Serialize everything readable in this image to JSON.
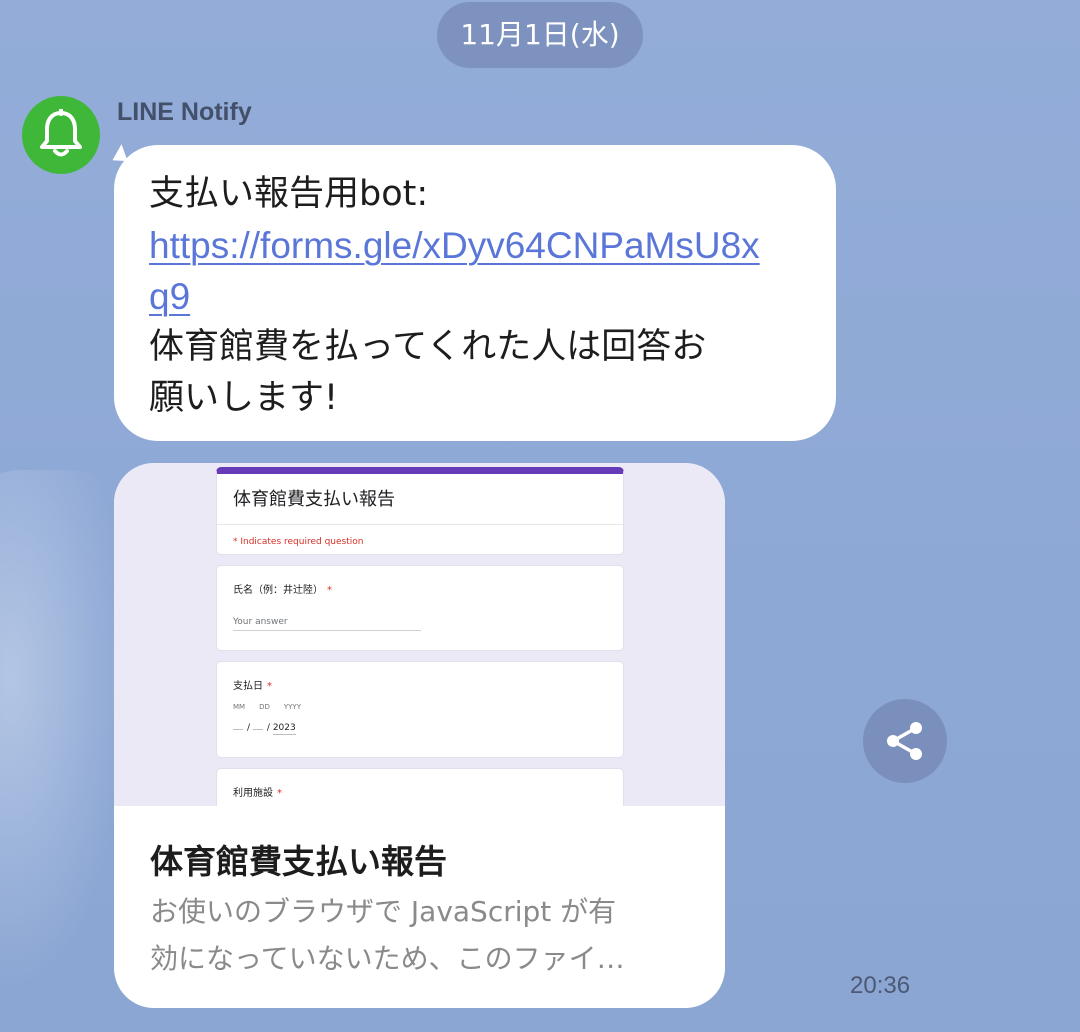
{
  "date_separator": "11月1日(水)",
  "message": {
    "sender": "LINE Notify",
    "avatar_icon": "bell-icon",
    "text_prefix": "支払い報告用bot:",
    "link_line1": "https://forms.gle/xDyv64CNPaMsU8x",
    "link_line2": "q9",
    "text_line1": "体育館費を払ってくれた人は回答お",
    "text_line2": "願いします!",
    "time": "20:36"
  },
  "link_card": {
    "title": "体育館費支払い報告",
    "description_line1": "お使いのブラウザで JavaScript が有",
    "description_line2": "効になっていないため、このファイ…",
    "preview": {
      "form_title": "体育館費支払い報告",
      "required_note": "* Indicates required question",
      "q1_label": "氏名（例：井辻陸）",
      "q1_placeholder": "Your answer",
      "q2_label": "支払日",
      "date_mm": "MM",
      "date_dd": "DD",
      "date_yyyy": "YYYY",
      "date_year_value": "2023",
      "q3_label": "利用施設",
      "required_mark": "*",
      "accent_color": "#673ab7"
    }
  },
  "share_icon": "share-icon",
  "colors": {
    "chat_background": "#8fa9d6",
    "avatar_green": "#3fb83a",
    "link_blue": "#5a76d8"
  }
}
